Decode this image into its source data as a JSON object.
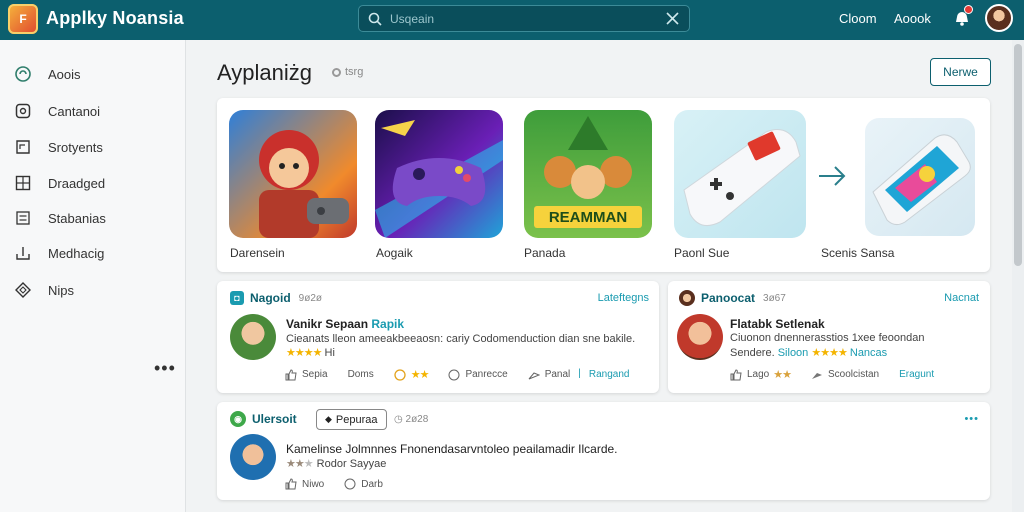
{
  "header": {
    "app_title": "Applky Noansia",
    "logo_text": "F",
    "search": {
      "value": "",
      "placeholder": "Usqeain"
    },
    "links": [
      "Cloom",
      "Aoook"
    ],
    "colors": {
      "topbar": "#0c5f6e",
      "accent": "#1a9bb0"
    }
  },
  "sidebar": {
    "items": [
      {
        "label": "Aoois",
        "icon": "circle-icon"
      },
      {
        "label": "Cantanoi",
        "icon": "square-icon"
      },
      {
        "label": "Srotyents",
        "icon": "corner-icon"
      },
      {
        "label": "Draadged",
        "icon": "grid-icon"
      },
      {
        "label": "Stabanias",
        "icon": "list-icon"
      },
      {
        "label": "Medhacig",
        "icon": "download-icon"
      },
      {
        "label": "Nips",
        "icon": "diamond-icon"
      }
    ],
    "more": "•••"
  },
  "main": {
    "title": "Ayplaniżg",
    "subtitle": "tsrg",
    "new_button": "Nerwe",
    "games": [
      {
        "label": "Darensein"
      },
      {
        "label": "Aogaik"
      },
      {
        "label": "Panada",
        "art_text": "REAMMAN"
      },
      {
        "label": "Paonl Sue"
      },
      {
        "label": "Scenis Sansa"
      }
    ],
    "posts": [
      {
        "brand": "Nagoid",
        "meta": "9ø2ø",
        "link": "Lateftegns",
        "name": "Vanikr Sepaan",
        "name_tag": "Rapik",
        "text": "Cieanats lleon ameeakbeeaosn: cariy Codomenduction dian sne bakile.",
        "stars": "★★★★",
        "rating_text": "Hi",
        "actions": [
          "Sepia",
          "Doms",
          "★★",
          "Panrecce",
          "Panal",
          "Rangand"
        ]
      },
      {
        "brand": "Panoocat",
        "meta": "3ø67",
        "link": "Nacnat",
        "name": "Flatabk Setlenak",
        "text_line1": "Ciuonon dnennerasstios 1xee feoondan",
        "text_line2_prefix": "Sendere.",
        "text_line2_link": "Siloon",
        "stars": "★★★★",
        "rating_link": "Nancas",
        "actions": [
          "Lago",
          "★★",
          "Scoolcistan",
          "Eragunt"
        ]
      },
      {
        "brand": "Ulersoit",
        "pill": "Pepuraa",
        "meta": "2ø28",
        "link": "•••",
        "text": "Kamelinse Jolmnnes Fnonendasarvntoleo peailamadir Ilcarde.",
        "stars": "★★",
        "rating_text": "Rodor Sayyae",
        "actions": [
          "Niwo",
          "Darb"
        ]
      }
    ]
  }
}
